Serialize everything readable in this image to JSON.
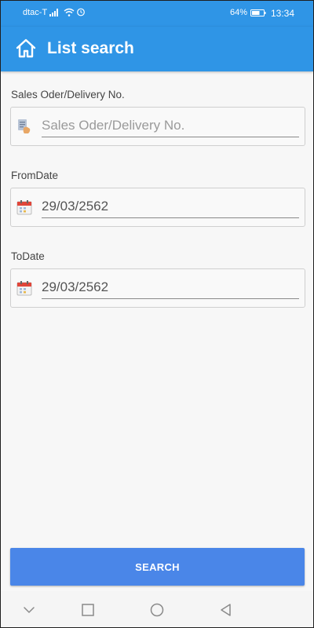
{
  "status_bar": {
    "carrier": "dtac-T",
    "battery_percent": "64%",
    "time": "13:34",
    "icons": [
      "signal-icon",
      "wifi-icon",
      "alarm-icon",
      "battery-icon"
    ]
  },
  "app_bar": {
    "title": "List search",
    "icon": "home-icon"
  },
  "form": {
    "sales_order": {
      "label": "Sales Oder/Delivery No.",
      "placeholder": "Sales Oder/Delivery No.",
      "value": "",
      "icon": "document-hand-icon"
    },
    "from_date": {
      "label": "FromDate",
      "value": "29/03/2562",
      "icon": "calendar-icon"
    },
    "to_date": {
      "label": "ToDate",
      "value": "29/03/2562",
      "icon": "calendar-icon"
    }
  },
  "actions": {
    "search_label": "SEARCH"
  },
  "nav_bar": {
    "buttons": [
      "hide-keyboard-icon",
      "recent-apps-icon",
      "home-circle-icon",
      "back-icon"
    ]
  },
  "colors": {
    "primary": "#2f95e6",
    "button": "#4a86e8",
    "background": "#f7f7f7"
  }
}
